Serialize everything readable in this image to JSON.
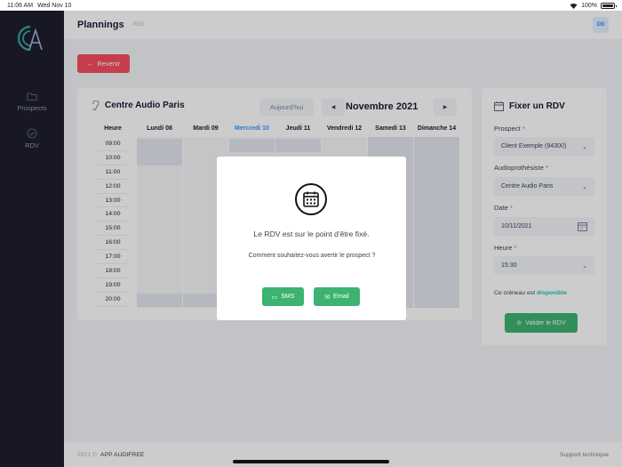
{
  "statusbar": {
    "time": "11:06 AM",
    "date": "Wed Nov 10",
    "battery": "100%"
  },
  "sidebar": {
    "items": [
      {
        "label": "Prospects",
        "icon": "folder-icon"
      },
      {
        "label": "RDV",
        "icon": "check-circle-icon"
      }
    ]
  },
  "header": {
    "title": "Plannings",
    "breadcrumb": "RDV",
    "user_initials": "DB"
  },
  "back_label": "Revenir",
  "calendar": {
    "center_name": "Centre Audio Paris",
    "today_label": "Aujourd'hui",
    "month_label": "Novembre 2021",
    "hour_header": "Heure",
    "days": [
      "Lundi 08",
      "Mardi 09",
      "Mercredi 10",
      "Jeudi 11",
      "Vendredi 12",
      "Samedi 13",
      "Dimanche 14"
    ],
    "today_index": 2,
    "hours": [
      "09:00",
      "10:00",
      "11:00",
      "12:00",
      "13:00",
      "14:00",
      "15:00",
      "16:00",
      "17:00",
      "18:00",
      "19:00",
      "20:00"
    ]
  },
  "rdv_form": {
    "title": "Fixer un RDV",
    "prospect_label": "Prospect",
    "prospect_value": "Client Exemple (94300)",
    "audio_label": "Audioprothésiste",
    "audio_value": "Centre Audio Paris",
    "date_label": "Date",
    "date_value": "10/11/2021",
    "heure_label": "Heure",
    "heure_value": "15:30",
    "avail_prefix": "Ce créneau est",
    "avail_status": "disponible",
    "validate_label": "Valider le RDV",
    "required_mark": "*"
  },
  "modal": {
    "message": "Le RDV est sur le point d'être fixé.",
    "question": "Comment souhaitez-vous avertir le prospect ?",
    "sms_label": "SMS",
    "email_label": "Email"
  },
  "footer": {
    "copyright": "2021 ©",
    "brand": "APP AUDIFREE",
    "support": "Support technique"
  },
  "colors": {
    "sidebar": "#1e1e2d",
    "danger": "#f64e60",
    "success": "#3cb371",
    "primary": "#3699ff"
  }
}
